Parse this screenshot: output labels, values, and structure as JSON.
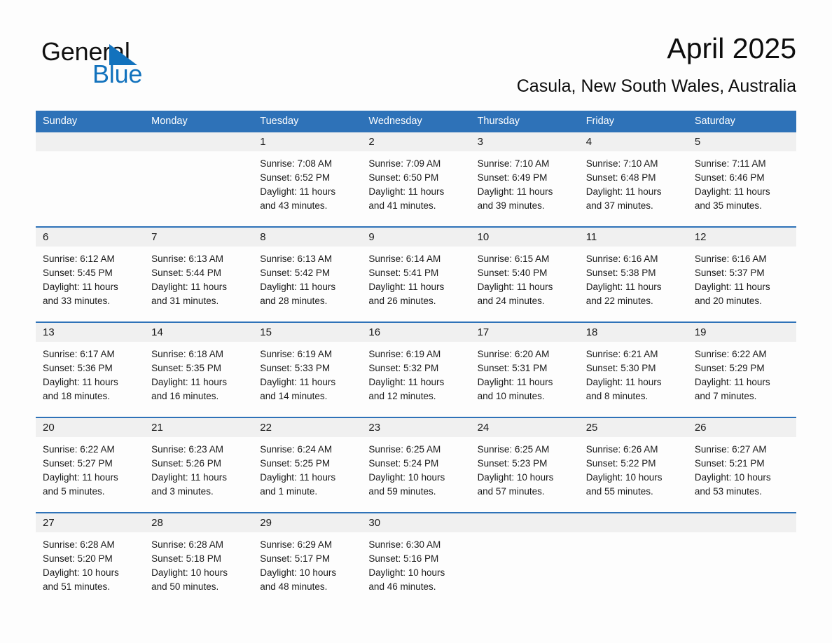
{
  "brand": {
    "name_dark": "General",
    "name_blue": "Blue",
    "triangle_color": "#1272bd"
  },
  "header": {
    "month_title": "April 2025",
    "location": "Casula, New South Wales, Australia"
  },
  "theme": {
    "header_blue": "#2e72b8",
    "daynum_band": "#f0f0f0",
    "page_background": "#fdfdfd",
    "text": "#1a1a1a"
  },
  "calendar": {
    "weekday_headers": [
      "Sunday",
      "Monday",
      "Tuesday",
      "Wednesday",
      "Thursday",
      "Friday",
      "Saturday"
    ],
    "weeks": [
      [
        {
          "day": "",
          "sunrise": "",
          "sunset": "",
          "daylight_line1": "",
          "daylight_line2": ""
        },
        {
          "day": "",
          "sunrise": "",
          "sunset": "",
          "daylight_line1": "",
          "daylight_line2": ""
        },
        {
          "day": "1",
          "sunrise": "Sunrise: 7:08 AM",
          "sunset": "Sunset: 6:52 PM",
          "daylight_line1": "Daylight: 11 hours",
          "daylight_line2": "and 43 minutes."
        },
        {
          "day": "2",
          "sunrise": "Sunrise: 7:09 AM",
          "sunset": "Sunset: 6:50 PM",
          "daylight_line1": "Daylight: 11 hours",
          "daylight_line2": "and 41 minutes."
        },
        {
          "day": "3",
          "sunrise": "Sunrise: 7:10 AM",
          "sunset": "Sunset: 6:49 PM",
          "daylight_line1": "Daylight: 11 hours",
          "daylight_line2": "and 39 minutes."
        },
        {
          "day": "4",
          "sunrise": "Sunrise: 7:10 AM",
          "sunset": "Sunset: 6:48 PM",
          "daylight_line1": "Daylight: 11 hours",
          "daylight_line2": "and 37 minutes."
        },
        {
          "day": "5",
          "sunrise": "Sunrise: 7:11 AM",
          "sunset": "Sunset: 6:46 PM",
          "daylight_line1": "Daylight: 11 hours",
          "daylight_line2": "and 35 minutes."
        }
      ],
      [
        {
          "day": "6",
          "sunrise": "Sunrise: 6:12 AM",
          "sunset": "Sunset: 5:45 PM",
          "daylight_line1": "Daylight: 11 hours",
          "daylight_line2": "and 33 minutes."
        },
        {
          "day": "7",
          "sunrise": "Sunrise: 6:13 AM",
          "sunset": "Sunset: 5:44 PM",
          "daylight_line1": "Daylight: 11 hours",
          "daylight_line2": "and 31 minutes."
        },
        {
          "day": "8",
          "sunrise": "Sunrise: 6:13 AM",
          "sunset": "Sunset: 5:42 PM",
          "daylight_line1": "Daylight: 11 hours",
          "daylight_line2": "and 28 minutes."
        },
        {
          "day": "9",
          "sunrise": "Sunrise: 6:14 AM",
          "sunset": "Sunset: 5:41 PM",
          "daylight_line1": "Daylight: 11 hours",
          "daylight_line2": "and 26 minutes."
        },
        {
          "day": "10",
          "sunrise": "Sunrise: 6:15 AM",
          "sunset": "Sunset: 5:40 PM",
          "daylight_line1": "Daylight: 11 hours",
          "daylight_line2": "and 24 minutes."
        },
        {
          "day": "11",
          "sunrise": "Sunrise: 6:16 AM",
          "sunset": "Sunset: 5:38 PM",
          "daylight_line1": "Daylight: 11 hours",
          "daylight_line2": "and 22 minutes."
        },
        {
          "day": "12",
          "sunrise": "Sunrise: 6:16 AM",
          "sunset": "Sunset: 5:37 PM",
          "daylight_line1": "Daylight: 11 hours",
          "daylight_line2": "and 20 minutes."
        }
      ],
      [
        {
          "day": "13",
          "sunrise": "Sunrise: 6:17 AM",
          "sunset": "Sunset: 5:36 PM",
          "daylight_line1": "Daylight: 11 hours",
          "daylight_line2": "and 18 minutes."
        },
        {
          "day": "14",
          "sunrise": "Sunrise: 6:18 AM",
          "sunset": "Sunset: 5:35 PM",
          "daylight_line1": "Daylight: 11 hours",
          "daylight_line2": "and 16 minutes."
        },
        {
          "day": "15",
          "sunrise": "Sunrise: 6:19 AM",
          "sunset": "Sunset: 5:33 PM",
          "daylight_line1": "Daylight: 11 hours",
          "daylight_line2": "and 14 minutes."
        },
        {
          "day": "16",
          "sunrise": "Sunrise: 6:19 AM",
          "sunset": "Sunset: 5:32 PM",
          "daylight_line1": "Daylight: 11 hours",
          "daylight_line2": "and 12 minutes."
        },
        {
          "day": "17",
          "sunrise": "Sunrise: 6:20 AM",
          "sunset": "Sunset: 5:31 PM",
          "daylight_line1": "Daylight: 11 hours",
          "daylight_line2": "and 10 minutes."
        },
        {
          "day": "18",
          "sunrise": "Sunrise: 6:21 AM",
          "sunset": "Sunset: 5:30 PM",
          "daylight_line1": "Daylight: 11 hours",
          "daylight_line2": "and 8 minutes."
        },
        {
          "day": "19",
          "sunrise": "Sunrise: 6:22 AM",
          "sunset": "Sunset: 5:29 PM",
          "daylight_line1": "Daylight: 11 hours",
          "daylight_line2": "and 7 minutes."
        }
      ],
      [
        {
          "day": "20",
          "sunrise": "Sunrise: 6:22 AM",
          "sunset": "Sunset: 5:27 PM",
          "daylight_line1": "Daylight: 11 hours",
          "daylight_line2": "and 5 minutes."
        },
        {
          "day": "21",
          "sunrise": "Sunrise: 6:23 AM",
          "sunset": "Sunset: 5:26 PM",
          "daylight_line1": "Daylight: 11 hours",
          "daylight_line2": "and 3 minutes."
        },
        {
          "day": "22",
          "sunrise": "Sunrise: 6:24 AM",
          "sunset": "Sunset: 5:25 PM",
          "daylight_line1": "Daylight: 11 hours",
          "daylight_line2": "and 1 minute."
        },
        {
          "day": "23",
          "sunrise": "Sunrise: 6:25 AM",
          "sunset": "Sunset: 5:24 PM",
          "daylight_line1": "Daylight: 10 hours",
          "daylight_line2": "and 59 minutes."
        },
        {
          "day": "24",
          "sunrise": "Sunrise: 6:25 AM",
          "sunset": "Sunset: 5:23 PM",
          "daylight_line1": "Daylight: 10 hours",
          "daylight_line2": "and 57 minutes."
        },
        {
          "day": "25",
          "sunrise": "Sunrise: 6:26 AM",
          "sunset": "Sunset: 5:22 PM",
          "daylight_line1": "Daylight: 10 hours",
          "daylight_line2": "and 55 minutes."
        },
        {
          "day": "26",
          "sunrise": "Sunrise: 6:27 AM",
          "sunset": "Sunset: 5:21 PM",
          "daylight_line1": "Daylight: 10 hours",
          "daylight_line2": "and 53 minutes."
        }
      ],
      [
        {
          "day": "27",
          "sunrise": "Sunrise: 6:28 AM",
          "sunset": "Sunset: 5:20 PM",
          "daylight_line1": "Daylight: 10 hours",
          "daylight_line2": "and 51 minutes."
        },
        {
          "day": "28",
          "sunrise": "Sunrise: 6:28 AM",
          "sunset": "Sunset: 5:18 PM",
          "daylight_line1": "Daylight: 10 hours",
          "daylight_line2": "and 50 minutes."
        },
        {
          "day": "29",
          "sunrise": "Sunrise: 6:29 AM",
          "sunset": "Sunset: 5:17 PM",
          "daylight_line1": "Daylight: 10 hours",
          "daylight_line2": "and 48 minutes."
        },
        {
          "day": "30",
          "sunrise": "Sunrise: 6:30 AM",
          "sunset": "Sunset: 5:16 PM",
          "daylight_line1": "Daylight: 10 hours",
          "daylight_line2": "and 46 minutes."
        },
        {
          "day": "",
          "sunrise": "",
          "sunset": "",
          "daylight_line1": "",
          "daylight_line2": ""
        },
        {
          "day": "",
          "sunrise": "",
          "sunset": "",
          "daylight_line1": "",
          "daylight_line2": ""
        },
        {
          "day": "",
          "sunrise": "",
          "sunset": "",
          "daylight_line1": "",
          "daylight_line2": ""
        }
      ]
    ]
  }
}
